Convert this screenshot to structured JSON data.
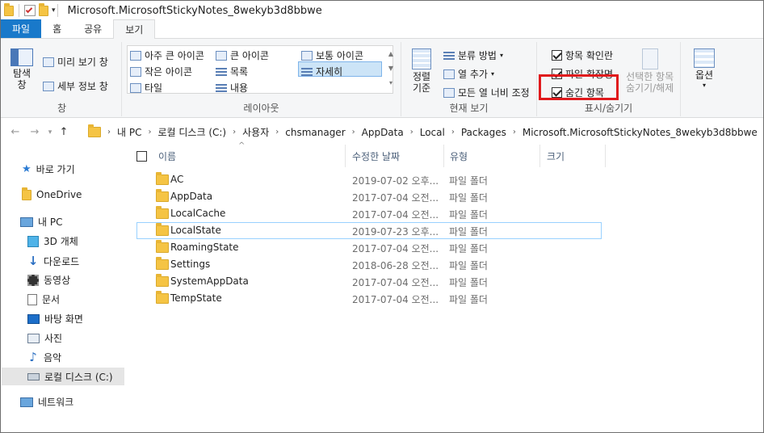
{
  "title": "Microsoft.MicrosoftStickyNotes_8wekyb3d8bbwe",
  "tabs": [
    "파일",
    "홈",
    "공유",
    "보기"
  ],
  "ribbon": {
    "pane_group": {
      "nav_pane": "탐색 창",
      "preview": "미리 보기 창",
      "details": "세부 정보 창",
      "label": "창"
    },
    "layout_group": {
      "items": [
        "아주 큰 아이콘",
        "큰 아이콘",
        "보통 아이콘",
        "작은 아이콘",
        "목록",
        "자세히",
        "타일",
        "내용"
      ],
      "label": "레이아웃"
    },
    "current_view": {
      "sort": "정렬 기준",
      "group_by": "분류 방법",
      "add_col": "열 추가",
      "fit_cols": "모든 열 너비 조정",
      "label": "현재 보기"
    },
    "show_hide": {
      "item_check": "항목 확인란",
      "file_ext": "파일 확장명",
      "hidden": "숨긴 항목",
      "hide_sel": "선택한 항목",
      "hide_sel2": "숨기기/해제",
      "label": "표시/숨기기"
    },
    "options": "옵션"
  },
  "address": {
    "crumbs": [
      "내 PC",
      "로컬 디스크 (C:)",
      "사용자",
      "chsmanager",
      "AppData",
      "Local",
      "Packages",
      "Microsoft.MicrosoftStickyNotes_8wekyb3d8bbwe"
    ]
  },
  "nav": {
    "quick": "바로 가기",
    "onedrive": "OneDrive",
    "pc": "내 PC",
    "items": [
      "3D 개체",
      "다운로드",
      "동영상",
      "문서",
      "바탕 화면",
      "사진",
      "음악",
      "로컬 디스크 (C:)"
    ],
    "network": "네트워크"
  },
  "columns": {
    "name": "이름",
    "date": "수정한 날짜",
    "type": "유형",
    "size": "크기"
  },
  "files": [
    {
      "name": "AC",
      "date": "2019-07-02 오후...",
      "type": "파일 폴더"
    },
    {
      "name": "AppData",
      "date": "2017-07-04 오전...",
      "type": "파일 폴더"
    },
    {
      "name": "LocalCache",
      "date": "2017-07-04 오전...",
      "type": "파일 폴더"
    },
    {
      "name": "LocalState",
      "date": "2019-07-23 오후...",
      "type": "파일 폴더"
    },
    {
      "name": "RoamingState",
      "date": "2017-07-04 오전...",
      "type": "파일 폴더"
    },
    {
      "name": "Settings",
      "date": "2018-06-28 오전...",
      "type": "파일 폴더"
    },
    {
      "name": "SystemAppData",
      "date": "2017-07-04 오전...",
      "type": "파일 폴더"
    },
    {
      "name": "TempState",
      "date": "2017-07-04 오전...",
      "type": "파일 폴더"
    }
  ],
  "colors": {
    "file_tab": "#1979ca",
    "highlight": "#e0191c",
    "selection": "#cce4f7"
  }
}
